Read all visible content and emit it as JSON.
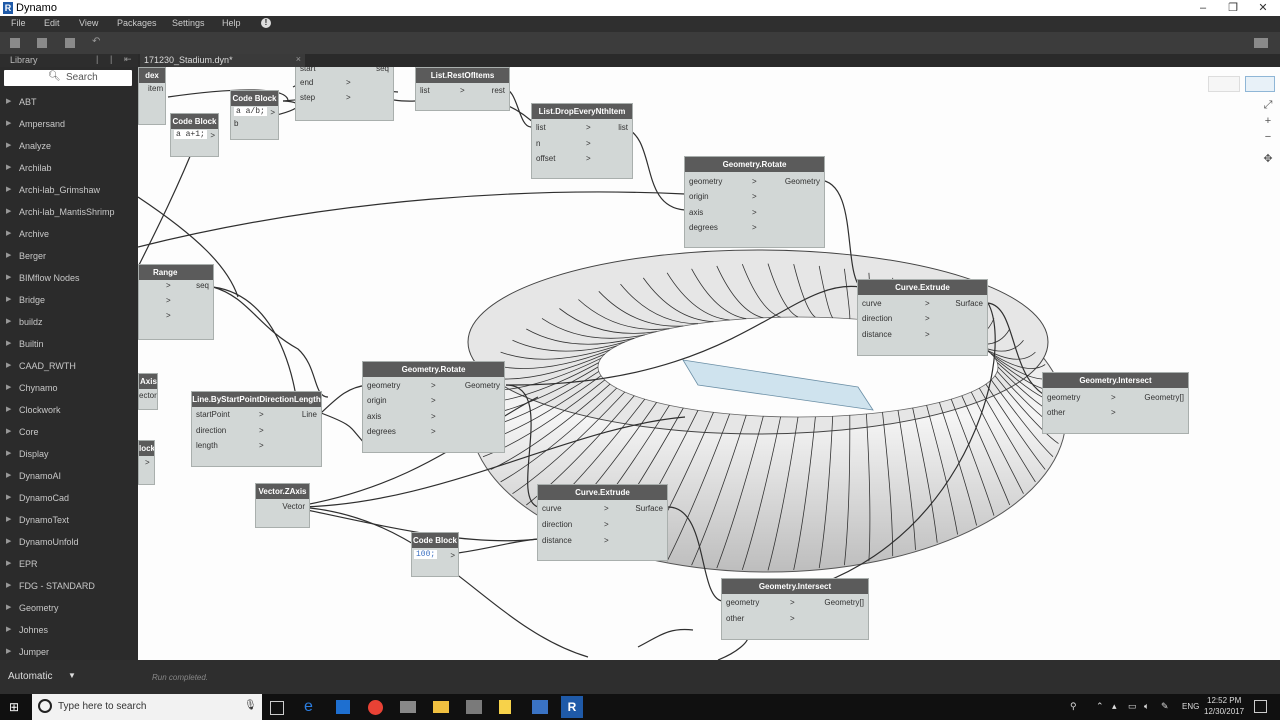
{
  "window": {
    "title": "Dynamo",
    "controls": [
      "–",
      "❐",
      "✕"
    ]
  },
  "menu": [
    "File",
    "Edit",
    "View",
    "Packages",
    "Settings",
    "Help"
  ],
  "library": {
    "header": "Library",
    "search_placeholder": "Search",
    "categories": [
      "ABT",
      "Ampersand",
      "Analyze",
      "Archilab",
      "Archi-lab_Grimshaw",
      "Archi-lab_MantisShrimp",
      "Archive",
      "Berger",
      "BIMflow Nodes",
      "Bridge",
      "buildz",
      "Builtin",
      "CAAD_RWTH",
      "Chynamo",
      "Clockwork",
      "Core",
      "Display",
      "DynamoAI",
      "DynamoCad",
      "DynamoText",
      "DynamoUnfold",
      "EPR",
      "FDG - STANDARD",
      "Geometry",
      "Johnes",
      "Jumper"
    ]
  },
  "tab": {
    "label": "171230_Stadium.dyn*",
    "close": "×"
  },
  "nodes": [
    {
      "title": "dex",
      "ports_in": [
        "item"
      ],
      "ports_out": []
    },
    {
      "title": "Code Block",
      "code": "a a+1;",
      "ports_out": [
        ">"
      ]
    },
    {
      "title": "Code Block",
      "code": "a a/b;",
      "ports_in": [
        "b"
      ],
      "ports_out": [
        ">"
      ]
    },
    {
      "title": "",
      "ports_in": [
        "start",
        "end",
        "step"
      ],
      "ports_out": [
        "seq"
      ]
    },
    {
      "title": "List.RestOfItems",
      "ports_in": [
        "list"
      ],
      "ports_out": [
        "rest"
      ]
    },
    {
      "title": "List.DropEveryNthItem",
      "ports_in": [
        "list",
        "n",
        "offset"
      ],
      "ports_out": [
        "list"
      ]
    },
    {
      "title": "Geometry.Rotate",
      "ports_in": [
        "geometry",
        "origin",
        "axis",
        "degrees"
      ],
      "ports_out": [
        "Geometry"
      ]
    },
    {
      "title": "Range",
      "ports_in": [],
      "ports_out": [
        "seq"
      ]
    },
    {
      "title": "Curve.Extrude",
      "ports_in": [
        "curve",
        "direction",
        "distance"
      ],
      "ports_out": [
        "Surface"
      ]
    },
    {
      "title": "Geometry.Intersect",
      "ports_in": [
        "geometry",
        "other"
      ],
      "ports_out": [
        "Geometry[]"
      ]
    },
    {
      "title": "Axis",
      "ports_out": [
        "ector"
      ]
    },
    {
      "title": "Line.ByStartPointDirectionLength",
      "ports_in": [
        "startPoint",
        "direction",
        "length"
      ],
      "ports_out": [
        "Line"
      ]
    },
    {
      "title": "Geometry.Rotate",
      "ports_in": [
        "geometry",
        "origin",
        "axis",
        "degrees"
      ],
      "ports_out": [
        "Geometry"
      ]
    },
    {
      "title": "lock",
      "ports_out": [
        ">"
      ]
    },
    {
      "title": "Vector.ZAxis",
      "ports_out": [
        "Vector"
      ]
    },
    {
      "title": "Curve.Extrude",
      "ports_in": [
        "curve",
        "direction",
        "distance"
      ],
      "ports_out": [
        "Surface"
      ]
    },
    {
      "title": "Code Block",
      "code": "100;",
      "ports_out": [
        ">"
      ]
    },
    {
      "title": "Geometry.Intersect",
      "ports_in": [
        "geometry",
        "other"
      ],
      "ports_out": [
        "Geometry[]"
      ]
    }
  ],
  "canvas_controls": [
    "⤢",
    "+",
    "−",
    "✥"
  ],
  "status": {
    "run_mode": "Automatic",
    "run_message": "Run completed."
  },
  "taskbar": {
    "search_placeholder": "Type here to search",
    "lang": "ENG",
    "time": "12:52 PM",
    "date": "12/30/2017"
  },
  "colors": {
    "node_body": "#d2d7d6",
    "node_header": "#5b5b5b",
    "dark_ui": "#2b2b2b",
    "wire": "#333333"
  }
}
